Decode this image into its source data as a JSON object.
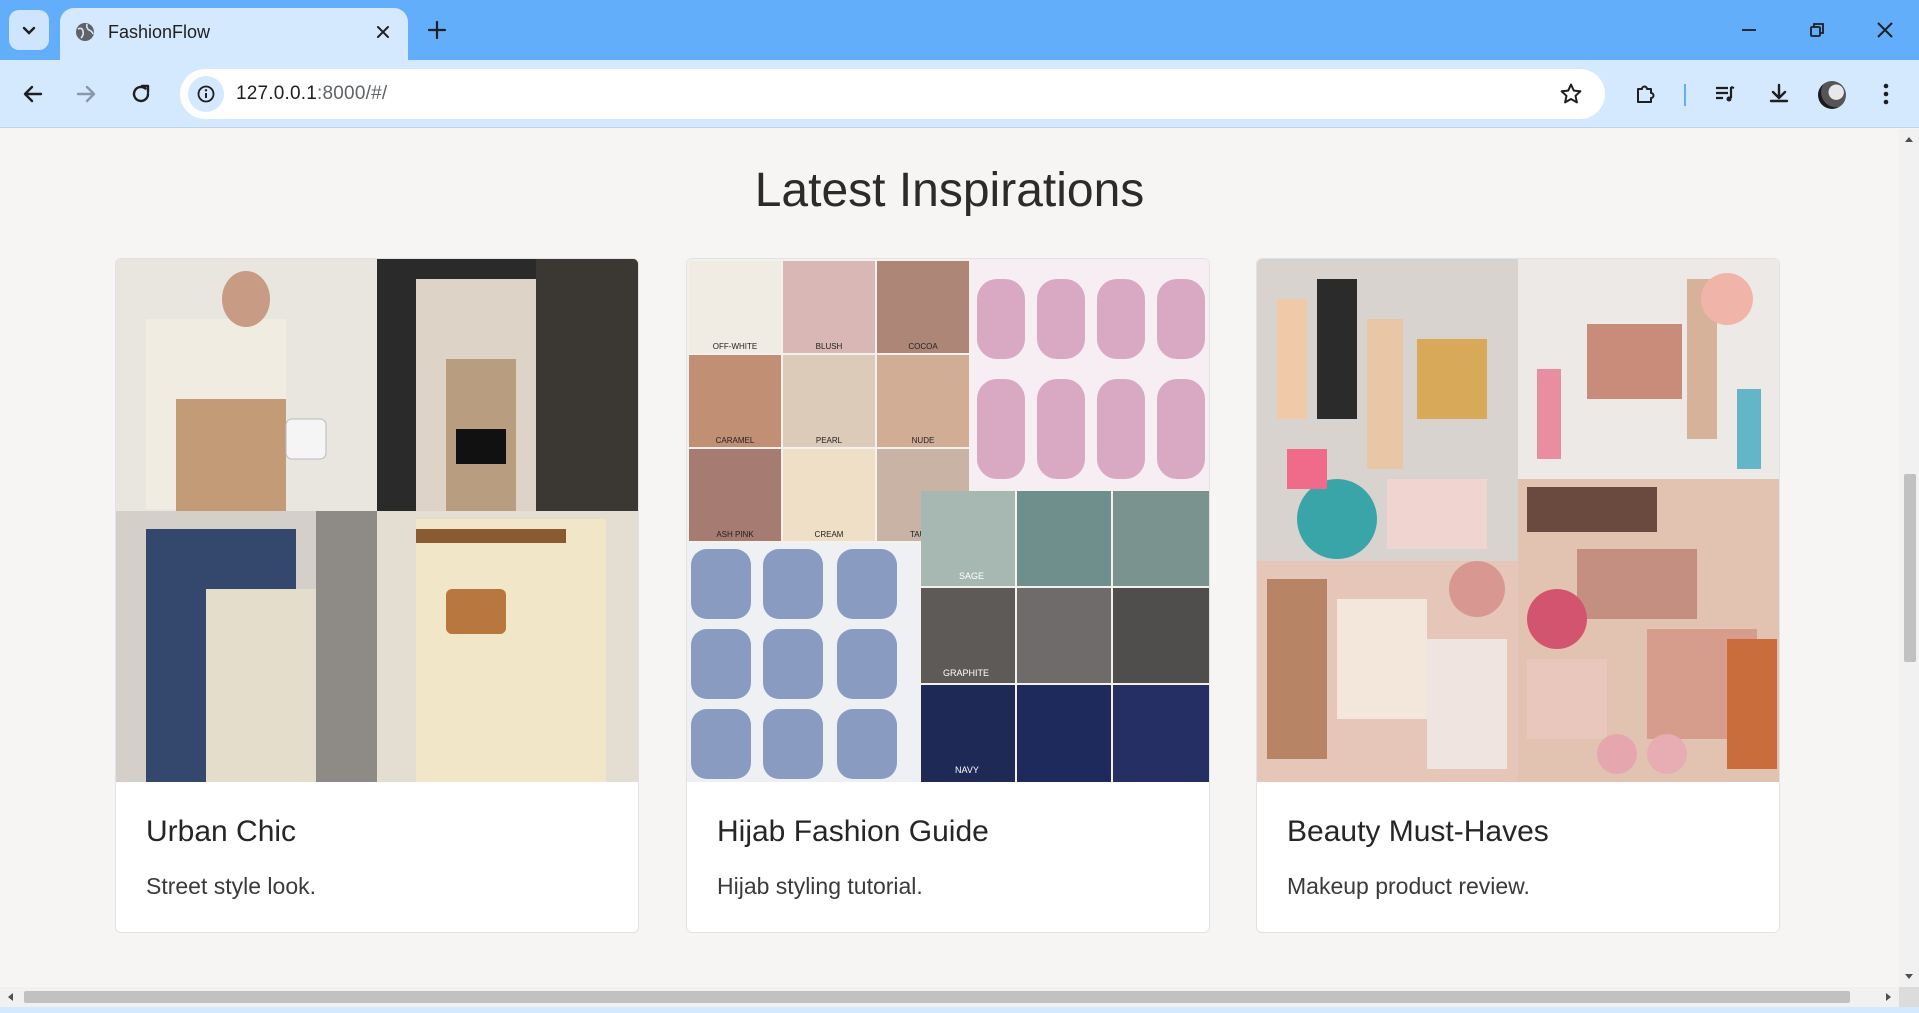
{
  "browser": {
    "tab_title": "FashionFlow",
    "url_host": "127.0.0.1",
    "url_rest": ":8000/#/"
  },
  "page": {
    "section_title": "Latest Inspirations",
    "cards": [
      {
        "title": "Urban Chic",
        "text": "Street style look."
      },
      {
        "title": "Hijab Fashion Guide",
        "text": "Hijab styling tutorial."
      },
      {
        "title": "Beauty Must-Haves",
        "text": "Makeup product review."
      }
    ]
  },
  "hijab_swatches": {
    "row1": [
      "OFF-WHITE",
      "BLUSH",
      "COCOA"
    ],
    "row2": [
      "CARAMEL",
      "PEARL",
      "NUDE"
    ],
    "row3": [
      "ASH PINK",
      "CREAM",
      "TAUPE"
    ],
    "extra": [
      "SAGE",
      "GRAPHITE",
      "NAVY"
    ]
  },
  "colors": {
    "tabbar": "#62aefa",
    "toolbar": "#d4e8fe",
    "page_bg": "#f6f5f4"
  }
}
